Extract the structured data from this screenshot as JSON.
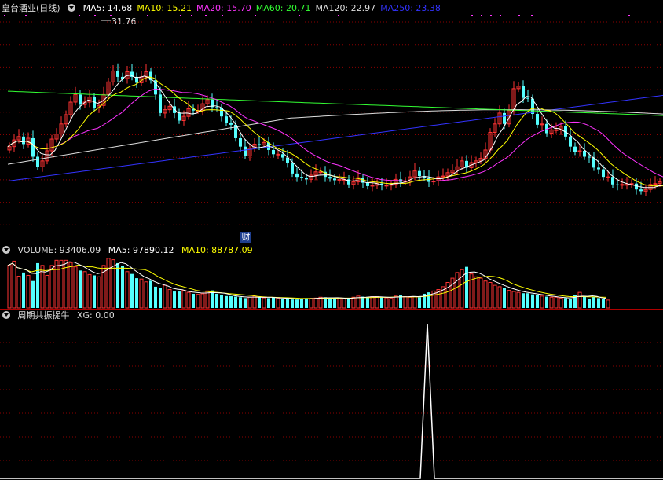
{
  "main": {
    "title": "皇台酒业(日线)",
    "ma": [
      {
        "label": "MA5: 14.68",
        "color": "#ffffff"
      },
      {
        "label": "MA10: 15.21",
        "color": "#ffff00"
      },
      {
        "label": "MA20: 15.70",
        "color": "#ff33ff"
      },
      {
        "label": "MA60: 20.71",
        "color": "#33ff33"
      },
      {
        "label": "MA120: 22.97",
        "color": "#dddddd"
      },
      {
        "label": "MA250: 23.38",
        "color": "#3333ff"
      }
    ],
    "peak_label": "31.76",
    "cai_label": "财"
  },
  "volume": {
    "title": "VOLUME: 93406.09",
    "ma5": "MA5: 97890.12",
    "ma10": "MA10: 88787.09"
  },
  "indicator": {
    "title": "周期共振捉牛",
    "xg": "XG: 0.00"
  },
  "colors": {
    "up": "#ff3333",
    "down": "#54ffff",
    "grid": "#8b0000",
    "separator": "#b00000"
  },
  "chart_data": {
    "type": "candlestick",
    "price_range": [
      8,
      34
    ],
    "closes": [
      18.6,
      19.4,
      19.8,
      18.9,
      19.6,
      17.4,
      16.2,
      16.9,
      18.1,
      19.5,
      20.1,
      21.3,
      22.4,
      23.9,
      24.8,
      23.6,
      23.9,
      24.5,
      23.2,
      23.5,
      24.8,
      26.3,
      27.6,
      26.9,
      26.7,
      27.5,
      26.9,
      26.2,
      26.9,
      27.5,
      26.5,
      24.8,
      22.6,
      23.0,
      23.4,
      22.6,
      21.7,
      22.2,
      23.1,
      22.9,
      22.9,
      23.7,
      24.2,
      23.3,
      23.2,
      22.2,
      21.4,
      21.2,
      19.6,
      18.6,
      17.5,
      18.4,
      18.9,
      18.8,
      19.1,
      18.2,
      17.7,
      17.7,
      17.3,
      16.7,
      15.4,
      15.0,
      14.9,
      14.7,
      15.2,
      15.6,
      15.6,
      15.0,
      14.8,
      14.6,
      14.7,
      14.7,
      14.1,
      14.4,
      14.9,
      14.3,
      13.9,
      14.0,
      14.2,
      14.0,
      14.0,
      14.1,
      14.7,
      14.4,
      14.5,
      15.0,
      15.7,
      15.1,
      14.9,
      14.4,
      14.5,
      15.0,
      15.1,
      15.5,
      15.8,
      16.2,
      16.9,
      16.1,
      16.7,
      16.9,
      17.2,
      18.2,
      20.3,
      21.3,
      22.6,
      21.3,
      22.9,
      25.5,
      25.8,
      24.4,
      24.3,
      22.5,
      21.2,
      21.3,
      20.2,
      20.6,
      20.6,
      21.0,
      19.8,
      18.6,
      18.0,
      18.1,
      17.4,
      17.3,
      16.1,
      15.9,
      15.0,
      15.0,
      14.1,
      14.0,
      14.1,
      14.1,
      14.2,
      13.5,
      13.3,
      13.5,
      14.1,
      14.2,
      14.4,
      13.9,
      14.0,
      13.8,
      13.4,
      11.7
    ],
    "volumes": [
      150,
      165,
      112,
      125,
      115,
      95,
      158,
      150,
      115,
      150,
      168,
      168,
      168,
      160,
      145,
      132,
      128,
      118,
      115,
      110,
      150,
      175,
      170,
      158,
      148,
      128,
      120,
      105,
      102,
      92,
      96,
      75,
      70,
      80,
      65,
      58,
      58,
      62,
      55,
      50,
      48,
      50,
      60,
      62,
      50,
      45,
      42,
      42,
      40,
      38,
      35,
      38,
      42,
      38,
      36,
      35,
      38,
      35,
      33,
      32,
      30,
      30,
      32,
      35,
      34,
      35,
      38,
      38,
      35,
      34,
      36,
      33,
      32,
      38,
      42,
      40,
      38,
      40,
      40,
      38,
      36,
      34,
      42,
      45,
      40,
      38,
      40,
      38,
      50,
      55,
      60,
      65,
      75,
      90,
      105,
      125,
      135,
      145,
      120,
      110,
      105,
      95,
      90,
      80,
      75,
      70,
      62,
      58,
      55,
      52,
      52,
      48,
      45,
      42,
      40,
      38,
      38,
      35,
      35,
      32,
      45,
      55,
      42,
      32,
      40,
      35,
      32,
      28
    ],
    "vol_max": 180,
    "signal_index": 89,
    "signal_value": 1
  }
}
